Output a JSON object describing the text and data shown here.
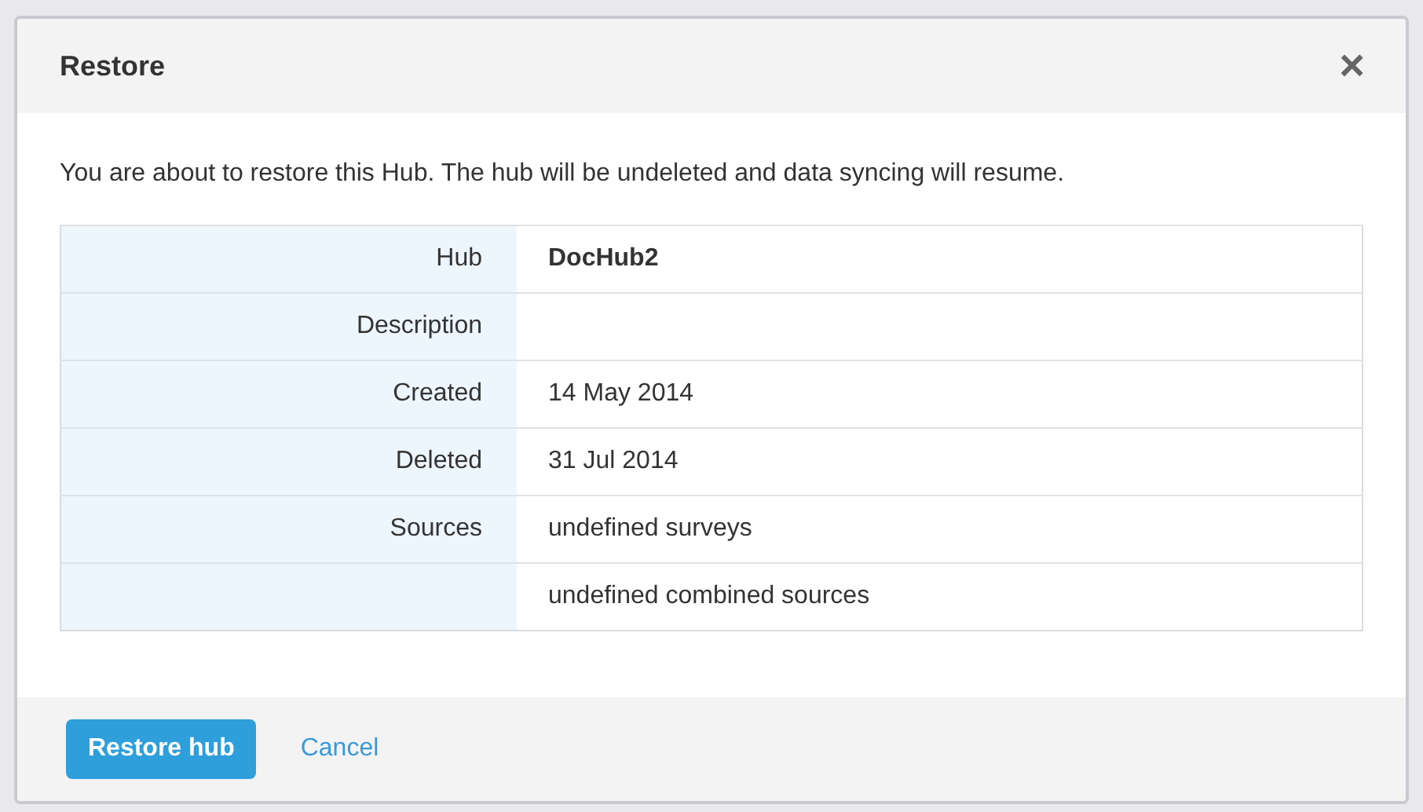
{
  "dialog": {
    "title": "Restore",
    "close": "×"
  },
  "message": "You are about to restore this Hub. The hub will be undeleted and data syncing will resume.",
  "details": [
    {
      "label": "Hub",
      "value": "DocHub2",
      "bold": true
    },
    {
      "label": "Description"
    },
    {
      "label": "Created",
      "value": "14 May 2014",
      "bold": false
    },
    {
      "label": "Deleted",
      "value": "31 Jul 2014",
      "bold": false
    },
    {
      "label": "Sources",
      "value": "undefined surveys",
      "bold": false
    },
    {
      "value": "undefined combined sources",
      "bold": false
    }
  ],
  "buttons": {
    "primary": "Restore hub",
    "secondary": "Cancel"
  }
}
